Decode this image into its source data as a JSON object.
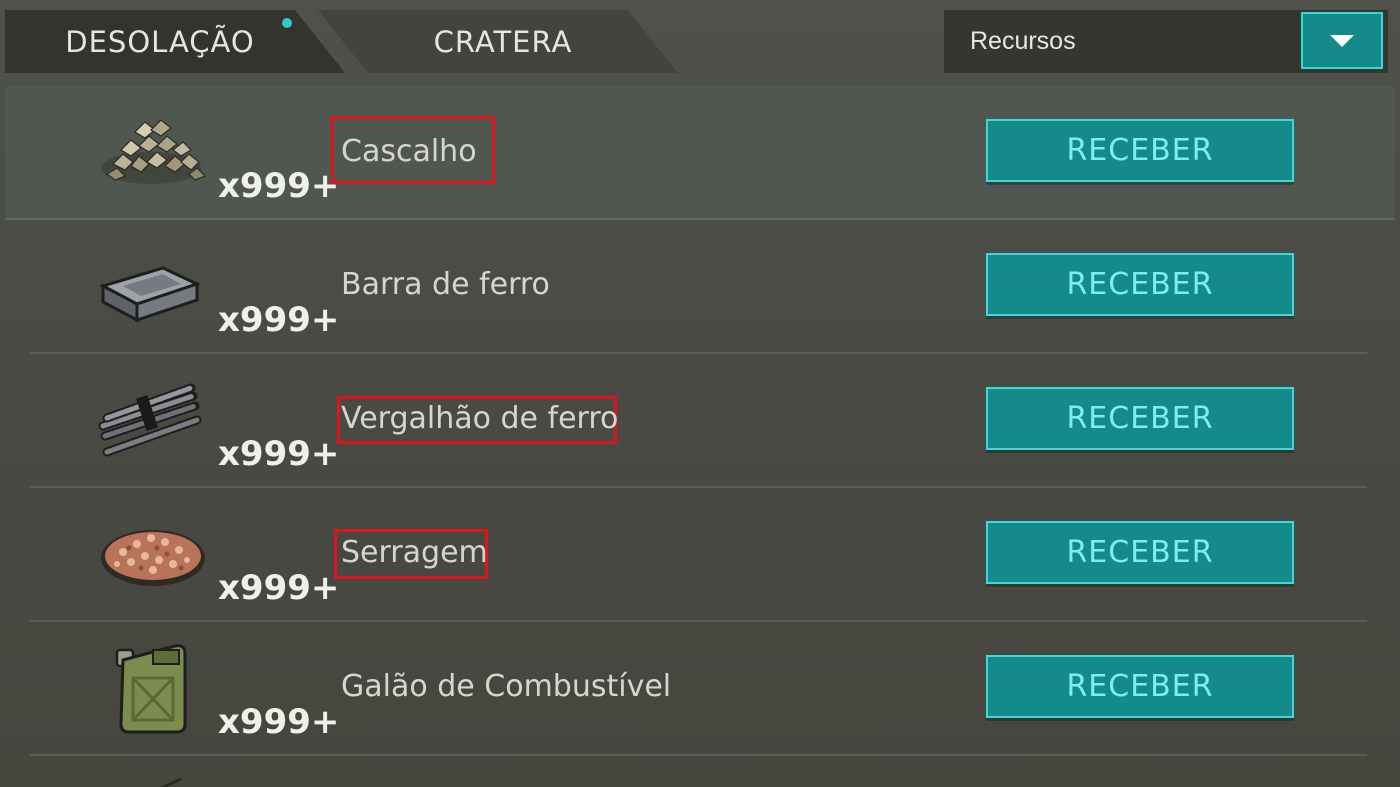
{
  "tabs": [
    {
      "label": "DESOLAÇÃO",
      "active": true,
      "has_notification": true
    },
    {
      "label": "CRATERA",
      "active": false
    }
  ],
  "filter": {
    "selected": "Recursos",
    "accent": "#148a8a"
  },
  "items": [
    {
      "name": "Cascalho",
      "qty": "x999+",
      "icon": "gravel-icon",
      "button": "RECEBER",
      "outlined": true
    },
    {
      "name": "Barra de ferro",
      "qty": "x999+",
      "icon": "iron-bar-icon",
      "button": "RECEBER",
      "outlined": false
    },
    {
      "name": "Vergalhão de ferro",
      "qty": "x999+",
      "icon": "iron-rebar-icon",
      "button": "RECEBER",
      "outlined": true
    },
    {
      "name": "Serragem",
      "qty": "x999+",
      "icon": "sawdust-icon",
      "button": "RECEBER",
      "outlined": true
    },
    {
      "name": "Galão de Combustível",
      "qty": "x999+",
      "icon": "fuel-canister-icon",
      "button": "RECEBER",
      "outlined": false
    }
  ],
  "colors": {
    "button_bg": "#158a8a",
    "button_border": "#3ed8d8",
    "button_text": "#7af0ee",
    "highlight_box": "#e0141c"
  }
}
